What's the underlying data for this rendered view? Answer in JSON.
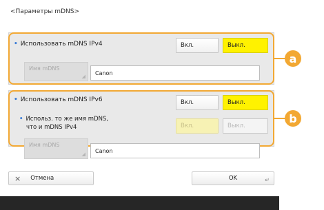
{
  "page": {
    "title": "<Параметры mDNS>"
  },
  "section_ipv4": {
    "label": "Использовать mDNS IPv4",
    "on_label": "Вкл.",
    "off_label": "Выкл.",
    "selected": "off",
    "name_label": "Имя mDNS",
    "name_value": "Canon",
    "marker": "a"
  },
  "section_ipv6": {
    "label": "Использовать mDNS IPv6",
    "on_label": "Вкл.",
    "off_label": "Выкл.",
    "selected": "off",
    "same_name_label_line1": "Использ. то же имя mDNS,",
    "same_name_label_line2": "что и mDNS IPv4",
    "same_on_label": "Вкл.",
    "same_off_label": "Выкл.",
    "name_label": "Имя mDNS",
    "name_value": "Canon",
    "marker": "b"
  },
  "footer": {
    "cancel_icon": "×",
    "cancel_label": "Отмена",
    "ok_label": "OK",
    "ok_icon": "↵"
  },
  "colors": {
    "highlight": "#f2a833",
    "selected_button": "#fff200",
    "bullet": "#3a7cd6"
  }
}
